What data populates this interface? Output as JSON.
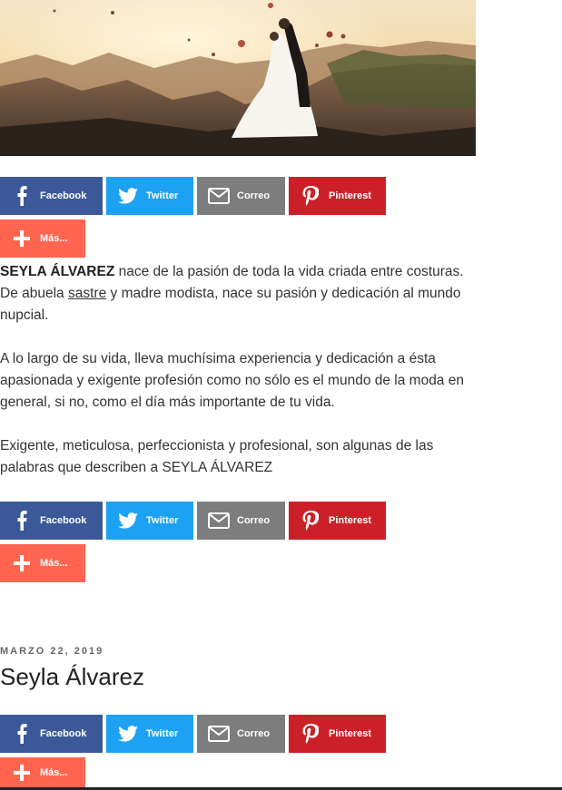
{
  "share": {
    "facebook": "Facebook",
    "twitter": "Twitter",
    "email": "Correo",
    "pinterest": "Pinterest",
    "more": "Más..."
  },
  "article": {
    "p1_bold": "SEYLA ÁLVAREZ",
    "p1_a": " nace de la pasión de toda la vida criada entre costuras. De abuela ",
    "p1_link": "sastre",
    "p1_b": " y madre modista, nace su pasión y dedicación al mundo nupcial.",
    "p2": "A lo largo de su vida, lleva muchísima experiencia y dedicación a ésta apasionada y exigente profesión como no sólo es el mundo de la moda en general, si no, como el día más importante de tu vida.",
    "p3": "Exigente, meticulosa, perfeccionista y profesional, son algunas de las palabras que describen a SEYLA ÁLVAREZ"
  },
  "post": {
    "date": "MARZO 22, 2019",
    "title": "Seyla Álvarez"
  },
  "icons": [
    "facebook-icon",
    "twitter-icon",
    "email-icon",
    "pinterest-icon",
    "plus-icon"
  ],
  "colors": {
    "facebook": "#3b5998",
    "twitter": "#1da1f2",
    "email": "#7d7d7d",
    "pinterest": "#cb2027",
    "more": "#ff6550"
  }
}
